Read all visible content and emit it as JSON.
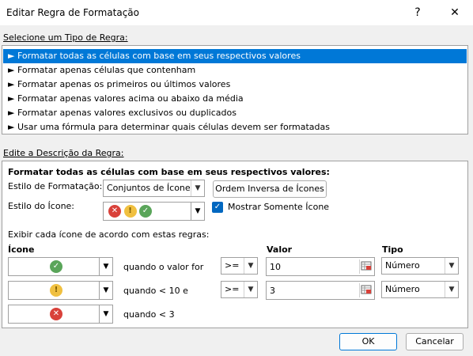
{
  "window": {
    "title": "Editar Regra de Formatação",
    "help": "?",
    "close": "✕"
  },
  "rule_type": {
    "label": "Selecione um Tipo de Regra:",
    "items": [
      "Formatar todas as células com base em seus respectivos valores",
      "Formatar apenas células que contenham",
      "Formatar apenas os primeiros ou últimos valores",
      "Formatar apenas valores acima ou abaixo da média",
      "Formatar apenas valores exclusivos ou duplicados",
      "Usar uma fórmula para determinar quais células devem ser formatadas"
    ],
    "selected_index": 0,
    "bullet": "►"
  },
  "description": {
    "label": "Edite a Descrição da Regra:",
    "heading": "Formatar todas as células com base em seus respectivos valores:",
    "format_style_label": "Estilo de Formatação:",
    "format_style_value": "Conjuntos de Ícones",
    "reverse_button": "Ordem Inversa de Ícones",
    "icon_style_label": "Estilo do Ícone:",
    "show_icon_only_label": "Mostrar Somente Ícone",
    "show_icon_only_checked": true,
    "rules_label": "Exibir cada ícone de acordo com estas regras:",
    "col_icon": "Ícone",
    "col_value": "Valor",
    "col_type": "Tipo",
    "rows": [
      {
        "icon": "green-check-icon",
        "condition": "quando o valor for",
        "operator": ">=",
        "value": "10",
        "type": "Número"
      },
      {
        "icon": "yellow-exclamation-icon",
        "condition": "quando < 10 e",
        "operator": ">=",
        "value": "3",
        "type": "Número"
      },
      {
        "icon": "red-x-icon",
        "condition": "quando < 3"
      }
    ]
  },
  "buttons": {
    "ok": "OK",
    "cancel": "Cancelar"
  },
  "colors": {
    "accent": "#0078d7",
    "green": "#5aa55a",
    "yellow": "#f0c040",
    "red": "#d9413a"
  }
}
